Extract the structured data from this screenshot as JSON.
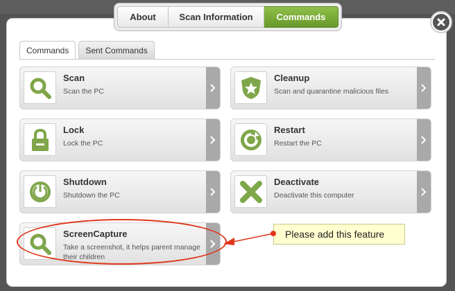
{
  "top_tabs": [
    {
      "label": "About",
      "active": false
    },
    {
      "label": "Scan Information",
      "active": false
    },
    {
      "label": "Commands",
      "active": true
    }
  ],
  "sub_tabs": [
    {
      "label": "Commands",
      "active": true
    },
    {
      "label": "Sent Commands",
      "active": false
    }
  ],
  "commands": [
    {
      "title": "Scan",
      "desc": "Scan the PC",
      "icon": "magnifier-icon"
    },
    {
      "title": "Cleanup",
      "desc": "Scan and quarantine malicious files",
      "icon": "shield-star-icon"
    },
    {
      "title": "Lock",
      "desc": "Lock the PC",
      "icon": "padlock-icon"
    },
    {
      "title": "Restart",
      "desc": "Restart the PC",
      "icon": "restart-icon"
    },
    {
      "title": "Shutdown",
      "desc": "Shutdown the PC",
      "icon": "power-icon"
    },
    {
      "title": "Deactivate",
      "desc": "Deactivate this computer",
      "icon": "x-mark-icon"
    },
    {
      "title": "ScreenCapture",
      "desc": "Take a screenshot, it helps parent manage their children",
      "icon": "magnifier-icon"
    }
  ],
  "annotation": {
    "text": "Please add this feature"
  },
  "colors": {
    "accent_green": "#7aab3a",
    "icon_green": "#8db35a",
    "annotation_red": "#e0361a",
    "note_yellow": "#ffffd0"
  }
}
